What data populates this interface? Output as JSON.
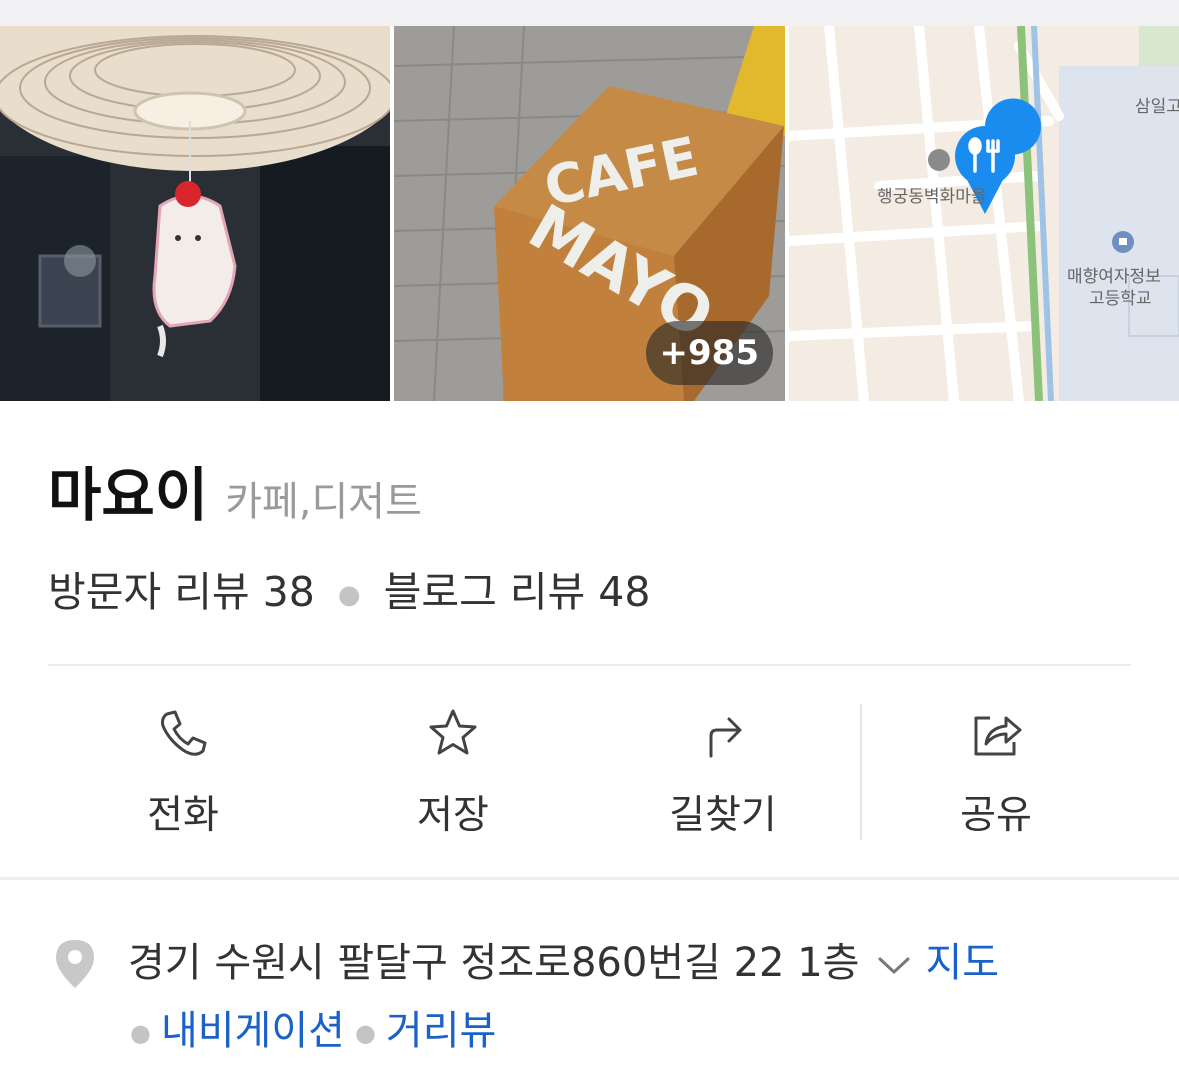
{
  "gallery": {
    "photo_count_badge": "+985",
    "photo2_sign_text_top": "CAFE",
    "photo2_sign_text_side": "MAYO",
    "map": {
      "labels": [
        "삼일고",
        "행궁동벽화마을",
        "매향여자정보",
        "고등학교"
      ]
    }
  },
  "place": {
    "name": "마요이",
    "category": "카페,디저트"
  },
  "reviews": {
    "visitor": "방문자 리뷰 38",
    "blog": "블로그 리뷰 48"
  },
  "actions": [
    {
      "label": "전화",
      "icon": "phone-icon"
    },
    {
      "label": "저장",
      "icon": "star-icon"
    },
    {
      "label": "길찾기",
      "icon": "directions-icon"
    },
    {
      "label": "공유",
      "icon": "share-icon"
    }
  ],
  "address": {
    "text": "경기 수원시 팔달구 정조로860번길 22 1층",
    "map_link": "지도",
    "navigation_link": "내비게이션",
    "streetview_link": "거리뷰"
  },
  "colors": {
    "link": "#1b62c8",
    "map_pin": "#1a8cf0"
  }
}
